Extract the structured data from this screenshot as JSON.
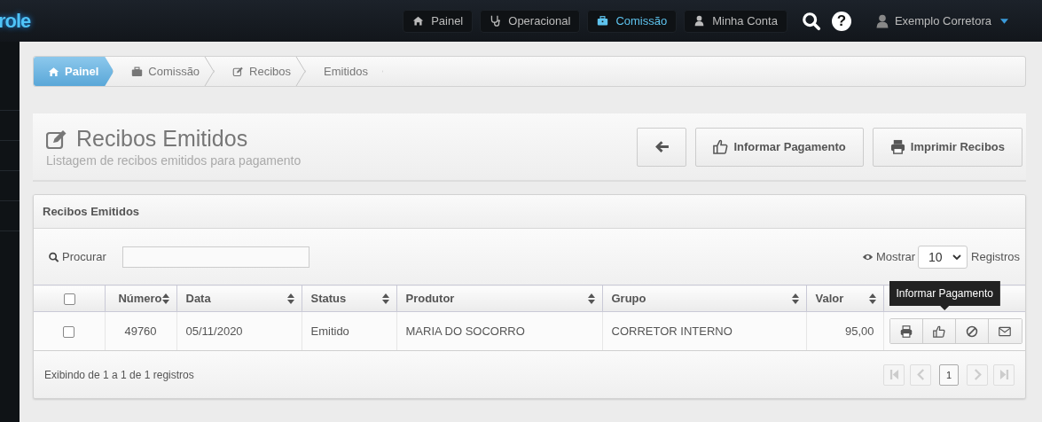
{
  "logo": {
    "text": "role"
  },
  "top_nav": [
    {
      "label": "Painel",
      "selected": false
    },
    {
      "label": "Operacional",
      "selected": false
    },
    {
      "label": "Comissão",
      "selected": true
    },
    {
      "label": "Minha Conta",
      "selected": false
    }
  ],
  "help": {
    "icon": "?"
  },
  "user_menu": {
    "label": "Exemplo Corretora"
  },
  "breadcrumb": [
    {
      "label": "Painel",
      "selected": true
    },
    {
      "label": "Comissão",
      "selected": false
    },
    {
      "label": "Recibos",
      "selected": false
    },
    {
      "label": "Emitidos",
      "selected": false
    }
  ],
  "page_header": {
    "title": "Recibos Emitidos",
    "subtitle": "Listagem de recibos emitidos para pagamento",
    "buttons": [
      "Informar Pagamento",
      "Imprimir Recibos"
    ]
  },
  "panel": {
    "title": "Recibos Emitidos",
    "search": {
      "label": "Procurar"
    },
    "page_size": {
      "label": "Mostrar",
      "value": "10",
      "suffix": "Registros"
    },
    "table": {
      "select_all_checked": false,
      "columns": [
        "Número",
        "Data",
        "Status",
        "Produtor",
        "Grupo",
        "Valor"
      ],
      "rows": [
        {
          "checked": false,
          "cells": [
            "49760",
            "05/11/2020",
            "Emitido",
            "MARIA DO SOCORRO",
            "CORRETOR INTERNO",
            "95,00"
          ]
        }
      ]
    },
    "tooltip": "Informar Pagamento",
    "info": "Exibindo de 1 a 1 de 1 registros",
    "pagination": {
      "nav": [
        {
          "disabled": true
        },
        {
          "disabled": true
        },
        {
          "disabled": true
        },
        {
          "disabled": true
        }
      ],
      "pages": [
        {
          "label": "1",
          "selected": true
        }
      ]
    }
  }
}
